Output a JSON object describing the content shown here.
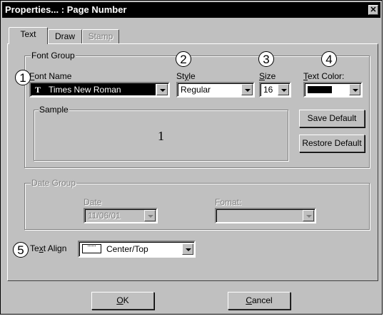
{
  "window": {
    "title": "Properties... : Page Number"
  },
  "tabs": [
    {
      "label": "Text",
      "active": true
    },
    {
      "label": "Draw",
      "active": false
    },
    {
      "label": "Stamp",
      "disabled": true
    }
  ],
  "font_group": {
    "legend": "Font Group",
    "font_name": {
      "label": "Font Name",
      "value": "Times New Roman",
      "icon": "truetype-icon"
    },
    "style": {
      "label": "Style",
      "value": "Regular"
    },
    "size": {
      "label": "Size",
      "value": "16"
    },
    "text_color": {
      "label": "Text Color:",
      "value_color": "#000000"
    },
    "sample": {
      "legend": "Sample",
      "text": "1"
    },
    "save_default": "Save Default",
    "restore_default": "Restore Default"
  },
  "date_group": {
    "legend": "Date Group",
    "date": {
      "label": "Date",
      "value": "11/06/01"
    },
    "format": {
      "label": "Fomat:",
      "value": ""
    }
  },
  "text_align": {
    "label": "Text Align",
    "value": "Center/Top"
  },
  "callouts": [
    "1",
    "2",
    "3",
    "4",
    "5"
  ],
  "buttons": {
    "ok": "OK",
    "cancel": "Cancel"
  }
}
